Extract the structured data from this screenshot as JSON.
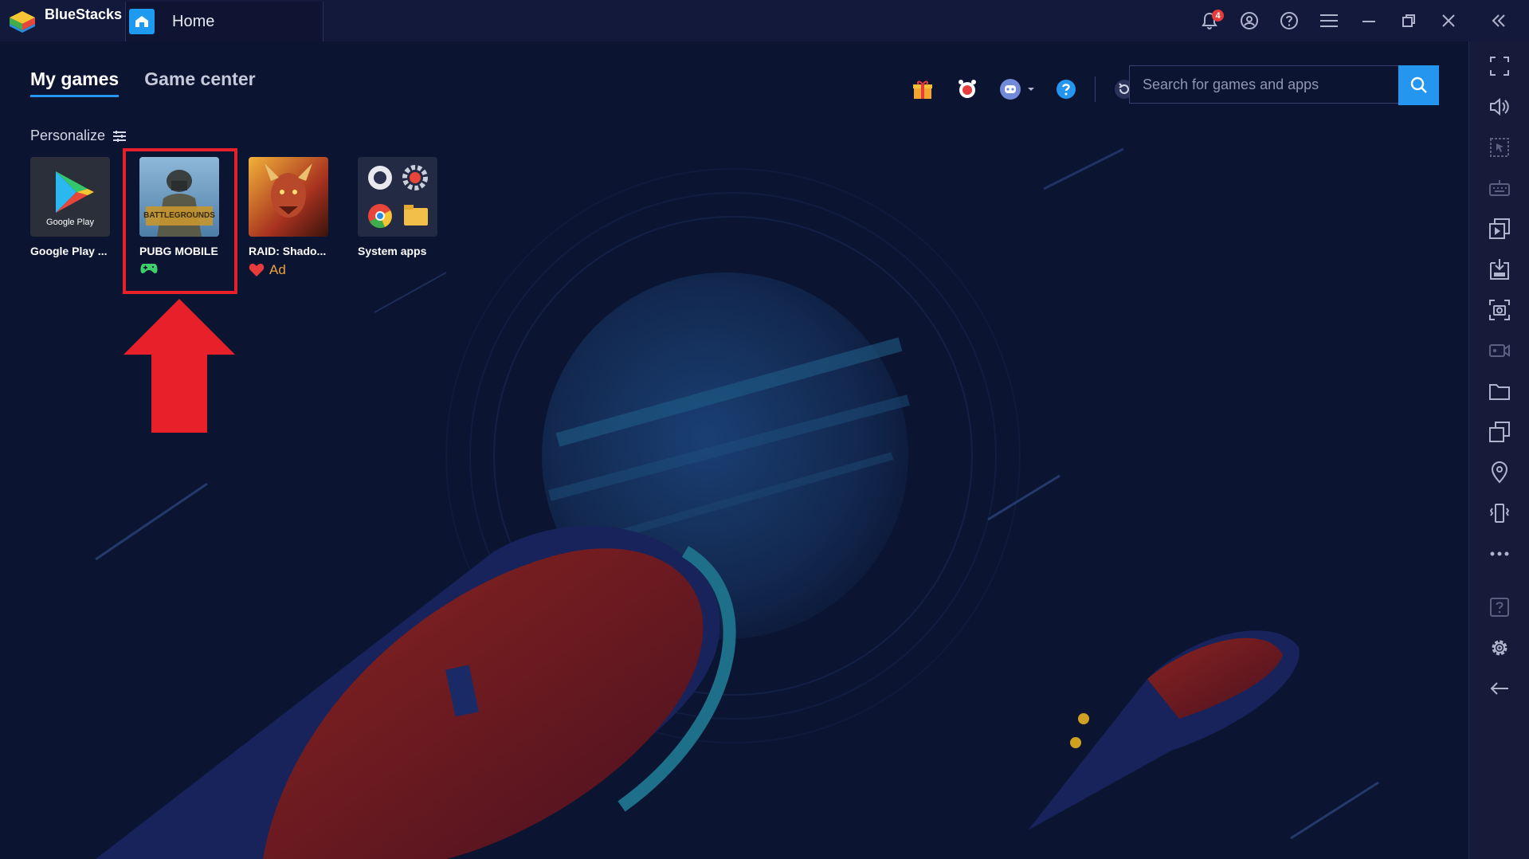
{
  "titlebar": {
    "app_name": "BlueStacks",
    "home_tab_label": "Home",
    "notification_count": "4"
  },
  "main": {
    "tabs": [
      {
        "label": "My games",
        "active": true
      },
      {
        "label": "Game center",
        "active": false
      }
    ],
    "search": {
      "placeholder": "Search for games and apps"
    },
    "personalize_label": "Personalize",
    "apps": [
      {
        "name": "Google Play ...",
        "thumb_label": "Google Play"
      },
      {
        "name": "PUBG MOBILE",
        "badge": "gamepad-icon",
        "thumb_label": "BATTLEGROUNDS"
      },
      {
        "name": "RAID: Shado...",
        "tag": "Ad"
      },
      {
        "name": "System apps"
      }
    ]
  },
  "colors": {
    "accent": "#2596f0",
    "highlight": "#e8202a",
    "background": "#0b1431",
    "sidebar": "#161b3a"
  }
}
